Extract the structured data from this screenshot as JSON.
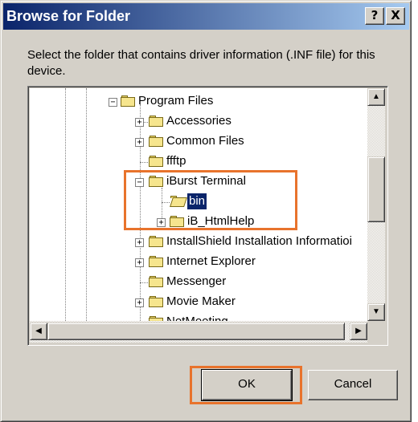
{
  "dialog": {
    "title": "Browse for Folder",
    "help_button": "?",
    "close_button": "X",
    "description": "Select the folder that contains driver information (.INF file) for this device."
  },
  "tree": {
    "nodes": [
      {
        "label": "Program Files",
        "expander": "−",
        "state": "expanded"
      },
      {
        "label": "Accessories",
        "expander": "+",
        "state": "collapsed"
      },
      {
        "label": "Common Files",
        "expander": "+",
        "state": "collapsed"
      },
      {
        "label": "ffftp",
        "expander": "",
        "state": "leaf"
      },
      {
        "label": "iBurst Terminal",
        "expander": "−",
        "state": "expanded"
      },
      {
        "label": "bin",
        "expander": "",
        "state": "selected"
      },
      {
        "label": "iB_HtmlHelp",
        "expander": "+",
        "state": "collapsed"
      },
      {
        "label": "InstallShield Installation Informatioi",
        "expander": "+",
        "state": "collapsed"
      },
      {
        "label": "Internet Explorer",
        "expander": "+",
        "state": "collapsed"
      },
      {
        "label": "Messenger",
        "expander": "",
        "state": "leaf"
      },
      {
        "label": "Movie Maker",
        "expander": "+",
        "state": "collapsed"
      },
      {
        "label": "NetMeeting",
        "expander": "",
        "state": "leaf"
      }
    ]
  },
  "scrollbars": {
    "up_arrow": "▲",
    "down_arrow": "▼",
    "left_arrow": "◀",
    "right_arrow": "▶"
  },
  "buttons": {
    "ok": "OK",
    "cancel": "Cancel"
  },
  "colors": {
    "title_start": "#0a246a",
    "title_end": "#a6caf0",
    "selection": "#0a246a",
    "highlight_box": "#e8732c",
    "face": "#d4d0c8"
  }
}
